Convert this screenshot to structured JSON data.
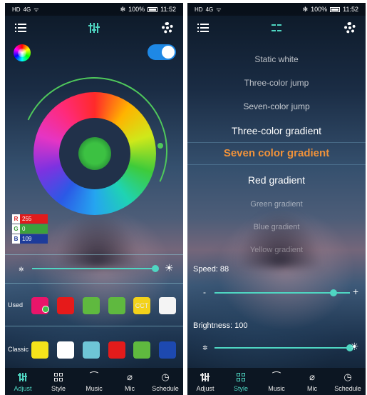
{
  "left": {
    "status": {
      "sim": "HD",
      "signal": "4G",
      "wifi": "ᯤ",
      "battery": "100%",
      "time": "11:52",
      "bt": "✻"
    },
    "rgb": {
      "r_label": "R",
      "r": "255",
      "g_label": "G",
      "g": "0",
      "b_label": "B",
      "b": "109"
    },
    "used": {
      "label": "Used",
      "swatches": [
        "#e9156a",
        "#e61a1a",
        "#5fb93f",
        "#5fb93f",
        "#f3d21a",
        "#f4f4f4"
      ],
      "cct_label": "CCT"
    },
    "classic": {
      "label": "Classic",
      "swatches": [
        "#f5e41b",
        "#ffffff",
        "#6ec5d6",
        "#e31b1b",
        "#5fb93f",
        "#1d49b0"
      ]
    },
    "brightness": 0.92,
    "accent": "#4fd6c2",
    "nav": [
      "Adjust",
      "Style",
      "Music",
      "Mic",
      "Schedule"
    ],
    "active_tab": "Adjust"
  },
  "right": {
    "status": {
      "sim": "HD",
      "signal": "4G",
      "wifi": "ᯤ",
      "battery": "100%",
      "time": "11:52",
      "bt": "✻"
    },
    "modes": [
      "Static white",
      "Three-color jump",
      "Seven-color jump",
      "Three-color gradient",
      "Seven color gradient",
      "Red gradient",
      "Green gradient",
      "Blue gradient",
      "Yellow gradient"
    ],
    "selected_mode": "Seven color gradient",
    "selected_color": "#f0923a",
    "speed_label": "Speed: 88",
    "speed_value": 88,
    "minus": "-",
    "plus": "+",
    "brightness_label": "Brightness: 100",
    "brightness_value": 100,
    "nav": [
      "Adjust",
      "Style",
      "Music",
      "Mic",
      "Schedule"
    ],
    "active_tab": "Style"
  },
  "icons": {
    "music": "⁀",
    "mic": "⌀",
    "schedule": "◷",
    "sun_small": "✲",
    "sun_large": "☀"
  }
}
